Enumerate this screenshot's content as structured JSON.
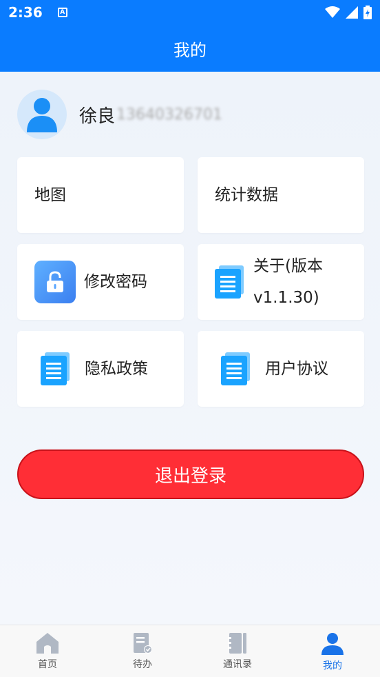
{
  "status_bar": {
    "time": "2:36",
    "notification_icon": "a-box-icon",
    "right_icons": [
      "wifi-icon",
      "signal-icon",
      "battery-icon"
    ]
  },
  "header": {
    "title": "我的"
  },
  "profile": {
    "name": "徐良",
    "phone": "13640326701"
  },
  "menu": {
    "map_label": "地图",
    "stats_label": "统计数据",
    "change_password_label": "修改密码",
    "about_label": "关于(版本v1.1.30)",
    "privacy_label": "隐私政策",
    "agreement_label": "用户协议"
  },
  "logout_label": "退出登录",
  "tabbar": {
    "tabs": [
      {
        "label": "首页",
        "icon": "home-icon"
      },
      {
        "label": "待办",
        "icon": "todo-icon"
      },
      {
        "label": "通讯录",
        "icon": "contacts-icon"
      },
      {
        "label": "我的",
        "icon": "user-icon"
      }
    ],
    "active_index": 3
  },
  "colors": {
    "primary": "#0a7cff",
    "logout": "#ff2e36",
    "tab_active": "#1a73e8",
    "tab_inactive": "#b0b8c4"
  }
}
